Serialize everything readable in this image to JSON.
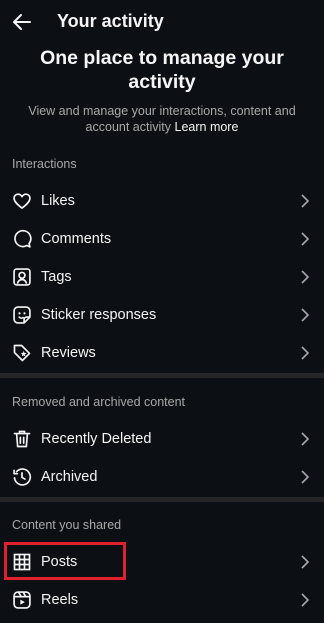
{
  "header": {
    "title": "Your activity",
    "back_icon": "arrow-left-icon"
  },
  "hero": {
    "title": "One place to manage your activity",
    "description": "View and manage your interactions, content and account activity",
    "learn_more": "Learn more"
  },
  "sections": {
    "interactions": {
      "heading": "Interactions",
      "items": [
        {
          "label": "Likes",
          "icon": "heart-icon"
        },
        {
          "label": "Comments",
          "icon": "comment-icon"
        },
        {
          "label": "Tags",
          "icon": "tag-person-icon"
        },
        {
          "label": "Sticker responses",
          "icon": "sticker-icon"
        },
        {
          "label": "Reviews",
          "icon": "review-tag-icon"
        }
      ]
    },
    "removed": {
      "heading": "Removed and archived content",
      "items": [
        {
          "label": "Recently Deleted",
          "icon": "trash-icon"
        },
        {
          "label": "Archived",
          "icon": "archive-clock-icon"
        }
      ]
    },
    "shared": {
      "heading": "Content you shared",
      "items": [
        {
          "label": "Posts",
          "icon": "grid-icon"
        },
        {
          "label": "Reels",
          "icon": "reels-icon"
        }
      ]
    }
  },
  "colors": {
    "background": "#0c1014",
    "text": "#f5f5f5",
    "secondary_text": "#a8a8a8",
    "divider": "#262626",
    "highlight_box": "#e0202c"
  }
}
